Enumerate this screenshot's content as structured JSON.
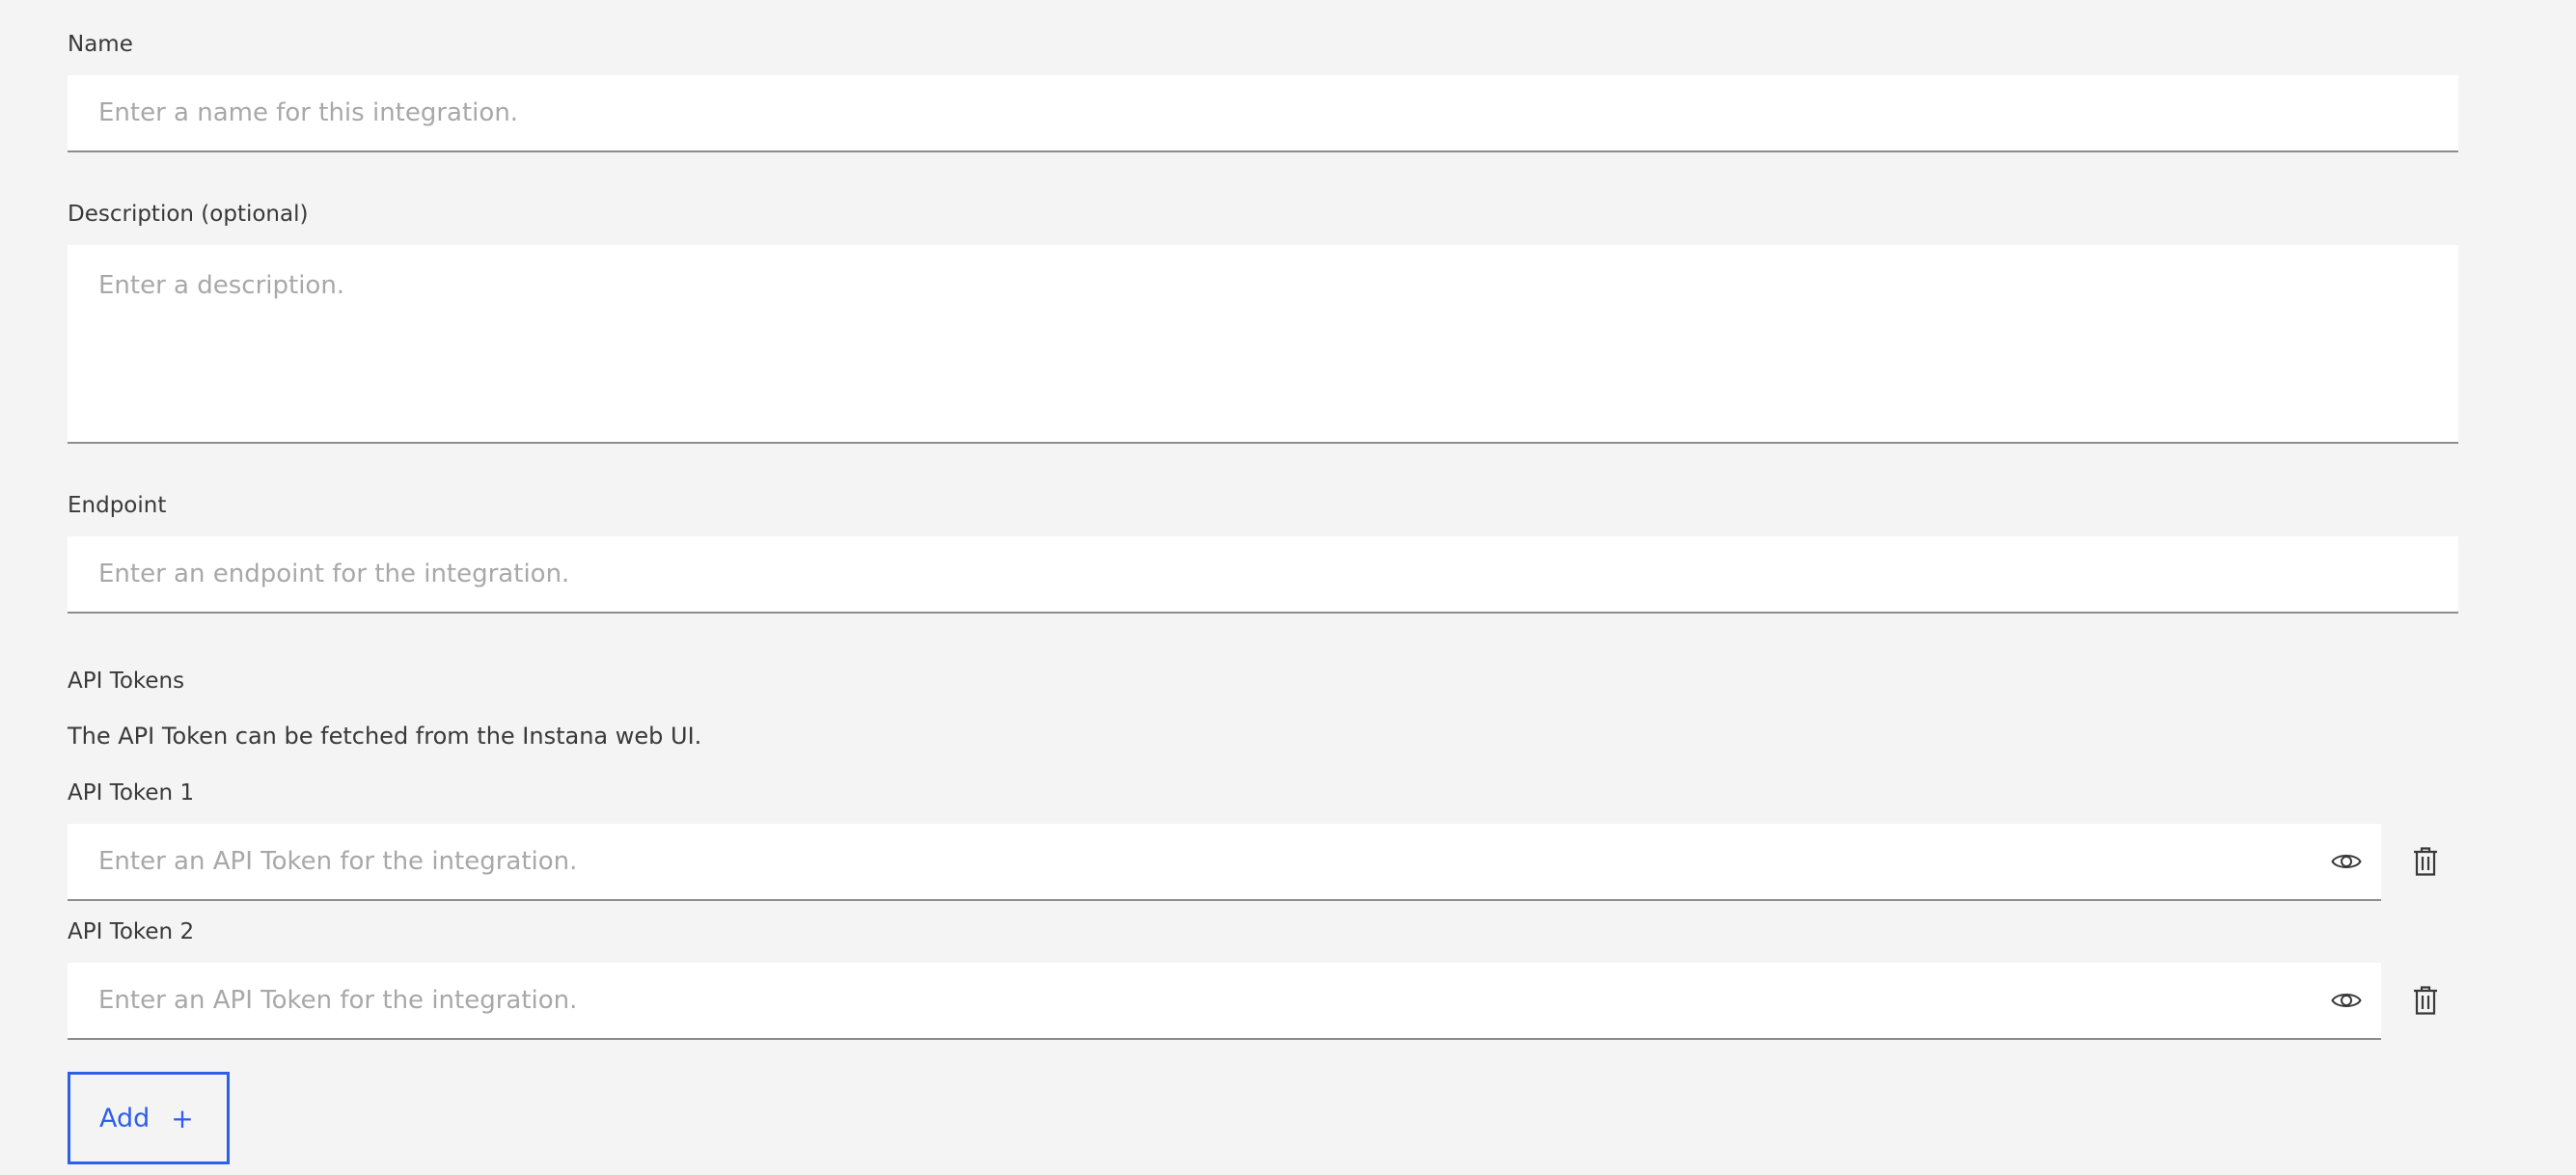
{
  "form": {
    "name": {
      "label": "Name",
      "value": "",
      "placeholder": "Enter a name for this integration."
    },
    "description": {
      "label": "Description (optional)",
      "value": "",
      "placeholder": "Enter a description."
    },
    "endpoint": {
      "label": "Endpoint",
      "value": "",
      "placeholder": "Enter an endpoint for the integration."
    },
    "api_tokens": {
      "heading": "API Tokens",
      "helper_text": "The API Token can be fetched from the Instana web UI.",
      "tokens": [
        {
          "label": "API Token 1",
          "value": "",
          "placeholder": "Enter an API Token for the integration.",
          "visibility_icon": "eye-icon",
          "delete_icon": "trash-icon"
        },
        {
          "label": "API Token 2",
          "value": "",
          "placeholder": "Enter an API Token for the integration.",
          "visibility_icon": "eye-icon",
          "delete_icon": "trash-icon"
        }
      ],
      "add_button": {
        "label": "Add",
        "icon": "plus-icon",
        "icon_glyph": "+"
      }
    }
  },
  "colors": {
    "background": "#f4f4f4",
    "field_background": "#ffffff",
    "field_border": "#8d8d8d",
    "placeholder": "#a8a8a8",
    "text": "#393939",
    "accent": "#2d5fea"
  }
}
